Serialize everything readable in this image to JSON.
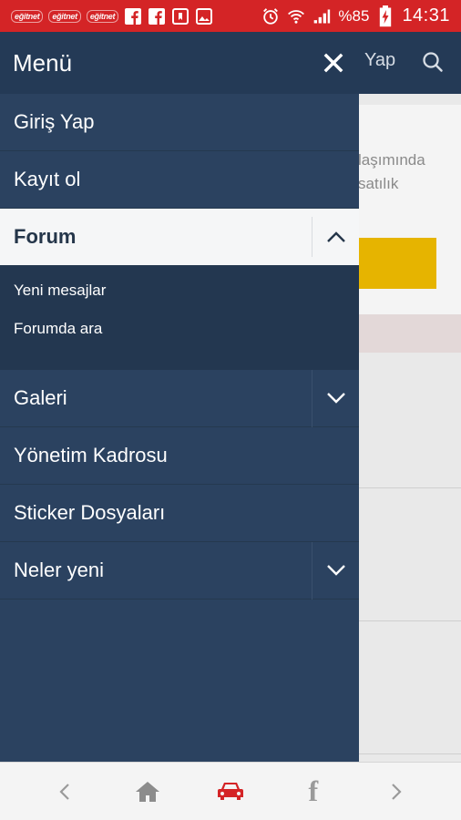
{
  "status_bar": {
    "brand_icons": [
      "eğitnet",
      "eğitnet",
      "eğitnet"
    ],
    "battery": "%85",
    "time": "14:31",
    "icons": [
      "facebook-icon",
      "facebook-icon",
      "bookmark-icon",
      "image-icon",
      "alarm-icon",
      "wifi-icon",
      "signal-icon",
      "battery-icon"
    ]
  },
  "background_app": {
    "header_login": "Yap",
    "text_line1": "laşımında",
    "text_line2": "satılık"
  },
  "drawer": {
    "title": "Menü",
    "items": [
      {
        "label": "Giriş Yap"
      },
      {
        "label": "Kayıt ol"
      },
      {
        "label": "Forum",
        "expanded": true,
        "subitems": [
          "Yeni mesajlar",
          "Forumda ara"
        ]
      },
      {
        "label": "Galeri",
        "expandable": true
      },
      {
        "label": "Yönetim Kadrosu"
      },
      {
        "label": "Sticker Dosyaları"
      },
      {
        "label": "Neler yeni",
        "expandable": true
      }
    ]
  },
  "bottom_nav": {
    "items": [
      "back-icon",
      "home-icon",
      "car-icon",
      "facebook-icon",
      "forward-icon"
    ],
    "active": "car-icon"
  },
  "colors": {
    "status_bar": "#d42426",
    "drawer_bg": "#2b4260",
    "drawer_header": "#243a56",
    "active_item_bg": "#f5f6f7",
    "accent_red": "#d42426"
  }
}
